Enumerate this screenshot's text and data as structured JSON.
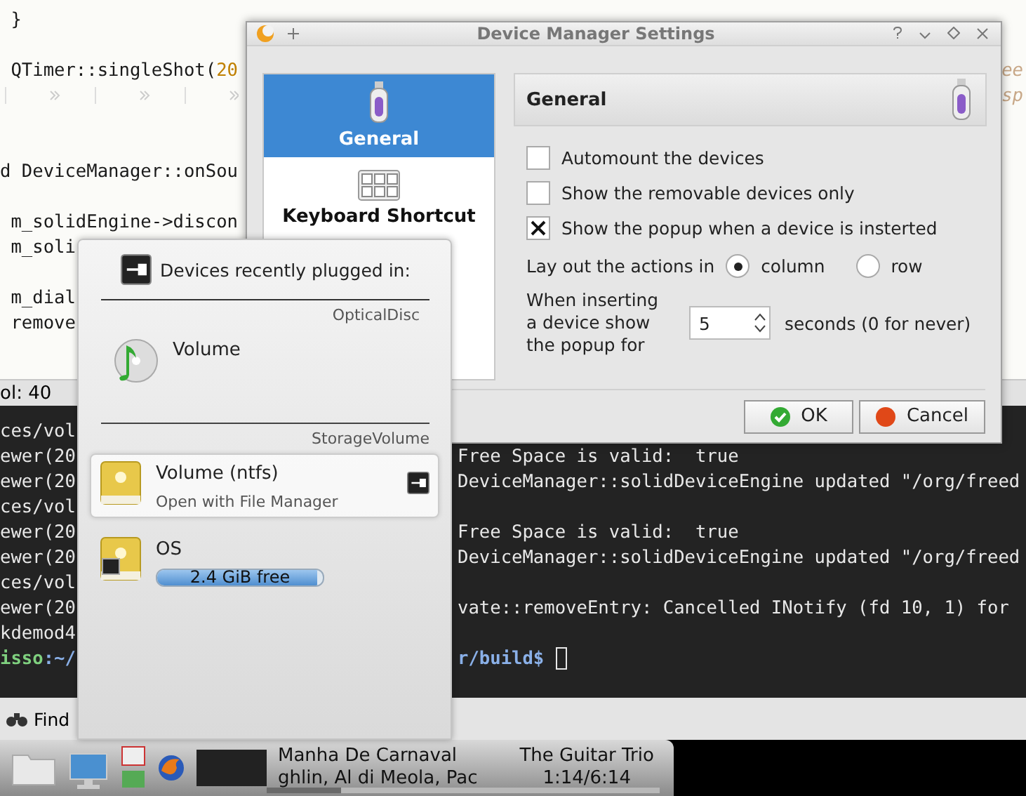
{
  "editor": {
    "lines": [
      {
        "kind": "code",
        "text": " }"
      },
      {
        "kind": "blank"
      },
      {
        "kind": "code",
        "text": " QTimer::singleShot(",
        "number": "20",
        "tail": "ee"
      },
      {
        "kind": "tabs",
        "tail": "sp"
      },
      {
        "kind": "blank"
      },
      {
        "kind": "blank"
      },
      {
        "kind": "code",
        "text": "d DeviceManager::onSou"
      },
      {
        "kind": "blank"
      },
      {
        "kind": "code",
        "text": " m_solidEngine->discon"
      },
      {
        "kind": "code",
        "text": " m_soli"
      },
      {
        "kind": "blank"
      },
      {
        "kind": "code",
        "text": " m_dial"
      },
      {
        "kind": "code",
        "text": " remove"
      }
    ],
    "status": "ol: 40"
  },
  "terminal": {
    "rows": [
      {
        "kind": "output",
        "left": "ces/vol"
      },
      {
        "kind": "output",
        "left": "ewer(20",
        "right": "Free Space is valid:  true"
      },
      {
        "kind": "output",
        "left": "ewer(20",
        "right": "DeviceManager::solidDeviceEngine updated \"/org/freed"
      },
      {
        "kind": "output",
        "left": "ces/vol"
      },
      {
        "kind": "output",
        "left": "ewer(20",
        "right": "Free Space is valid:  true"
      },
      {
        "kind": "output",
        "left": "ewer(20",
        "right": "DeviceManager::solidDeviceEngine updated \"/org/freed"
      },
      {
        "kind": "output",
        "left": "ces/vol"
      },
      {
        "kind": "output",
        "left": "ewer(20",
        "right": "vate::removeEntry: Cancelled INotify (fd 10, 1) for"
      },
      {
        "kind": "output",
        "left": "kdemod4"
      },
      {
        "kind": "prompt",
        "user": "isso",
        "left": ":~/",
        "right": "r/build$"
      }
    ]
  },
  "find_bar": {
    "label": "Find"
  },
  "dialog": {
    "title": "Device Manager Settings",
    "sidebar": [
      {
        "label": "General",
        "kind": "usb",
        "selected": true
      },
      {
        "label": "Keyboard Shortcut",
        "kind": "keyboard",
        "selected": false
      }
    ],
    "header": "General",
    "options": [
      {
        "label": "Automount the devices",
        "checked": false
      },
      {
        "label": "Show the removable devices only",
        "checked": false
      },
      {
        "label": "Show the popup when a device is insterted",
        "checked": true
      }
    ],
    "layout": {
      "label": "Lay out the actions in",
      "choices": [
        {
          "label": "column",
          "selected": true
        },
        {
          "label": "row",
          "selected": false
        }
      ]
    },
    "popup_time": {
      "label": "When inserting a device show the popup for",
      "value": "5",
      "suffix": "seconds (0 for never)"
    },
    "buttons": [
      {
        "label": "OK",
        "kind": "ok"
      },
      {
        "label": "Cancel",
        "kind": "cancel"
      }
    ]
  },
  "popup": {
    "title": "Devices recently plugged in:",
    "sections": [
      {
        "category": "OpticalDisc",
        "devices": [
          {
            "kind": "disc",
            "name": "Volume",
            "highlighted": false
          }
        ]
      },
      {
        "category": "StorageVolume",
        "devices": [
          {
            "kind": "drive",
            "name": "Volume (ntfs)",
            "action": "Open with File Manager",
            "highlighted": true,
            "mounted": false
          },
          {
            "kind": "drive",
            "name": "OS",
            "free": "2.4 GiB  free",
            "level": 0.97,
            "highlighted": false,
            "mounted": true
          }
        ]
      }
    ]
  },
  "taskbar": {
    "track": "Manha De Carnaval",
    "artist": "ghlin, Al di Meola, Pac",
    "album": "The Guitar Trio",
    "time": "1:14/6:14",
    "level": 0.19
  }
}
